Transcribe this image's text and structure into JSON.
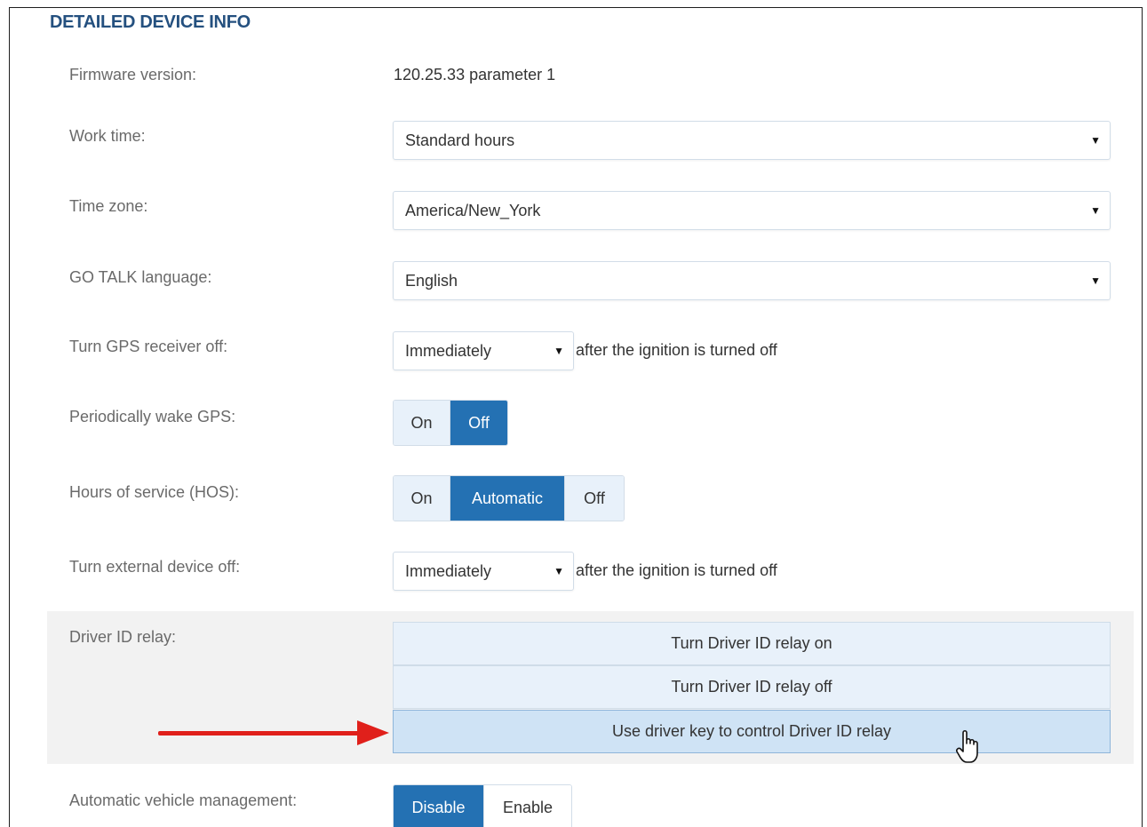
{
  "section": {
    "title": "DETAILED DEVICE INFO"
  },
  "firmware": {
    "label": "Firmware version:",
    "value": "120.25.33 parameter 1"
  },
  "work_time": {
    "label": "Work time:",
    "value": "Standard hours"
  },
  "time_zone": {
    "label": "Time zone:",
    "value": "America/New_York"
  },
  "go_talk": {
    "label": "GO TALK language:",
    "value": "English"
  },
  "gps_off": {
    "label": "Turn GPS receiver off:",
    "value": "Immediately",
    "suffix": "after the ignition is turned off"
  },
  "wake_gps": {
    "label": "Periodically wake GPS:",
    "options": [
      "On",
      "Off"
    ],
    "selected": "Off"
  },
  "hos": {
    "label": "Hours of service (HOS):",
    "options": [
      "On",
      "Automatic",
      "Off"
    ],
    "selected": "Automatic"
  },
  "ext_off": {
    "label": "Turn external device off:",
    "value": "Immediately",
    "suffix": "after the ignition is turned off"
  },
  "relay": {
    "label": "Driver ID relay:",
    "options": [
      "Turn Driver ID relay on",
      "Turn Driver ID relay off",
      "Use driver key to control Driver ID relay"
    ],
    "selected": "Use driver key to control Driver ID relay"
  },
  "avm": {
    "label": "Automatic vehicle management:",
    "options": [
      "Disable",
      "Enable"
    ],
    "selected": "Disable"
  },
  "icons": {
    "caret": "caret-down-icon",
    "arrow": "red-arrow-icon",
    "cursor": "hand-pointer-icon"
  },
  "colors": {
    "title": "#24507f",
    "active": "#2471b3",
    "inactive": "#e8f1fa",
    "arrow": "#e0201b"
  }
}
